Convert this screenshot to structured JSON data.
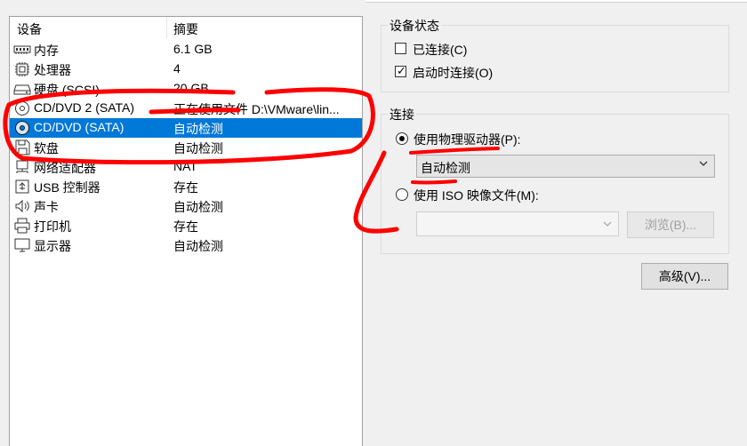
{
  "device_list": {
    "header_device": "设备",
    "header_summary": "摘要",
    "rows": [
      {
        "name": "内存",
        "summary": "6.1 GB",
        "icon": "memory-icon"
      },
      {
        "name": "处理器",
        "summary": "4",
        "icon": "processor-icon"
      },
      {
        "name": "硬盘 (SCSI)",
        "summary": "20 GB",
        "icon": "hard-disk-icon"
      },
      {
        "name": "CD/DVD 2 (SATA)",
        "summary": "正在使用文件 D:\\VMware\\lin...",
        "icon": "cd-dvd-icon"
      },
      {
        "name": "CD/DVD (SATA)",
        "summary": "自动检测",
        "icon": "cd-dvd-icon"
      },
      {
        "name": "软盘",
        "summary": "自动检测",
        "icon": "floppy-icon"
      },
      {
        "name": "网络适配器",
        "summary": "NAT",
        "icon": "network-adapter-icon"
      },
      {
        "name": "USB 控制器",
        "summary": "存在",
        "icon": "usb-icon"
      },
      {
        "name": "声卡",
        "summary": "自动检测",
        "icon": "sound-icon"
      },
      {
        "name": "打印机",
        "summary": "存在",
        "icon": "printer-icon"
      },
      {
        "name": "显示器",
        "summary": "自动检测",
        "icon": "display-icon"
      }
    ],
    "selected_index": 4
  },
  "device_status": {
    "title": "设备状态",
    "connected_label": "已连接(C)",
    "connected_checked": false,
    "connect_on_power_label": "启动时连接(O)",
    "connect_on_power_checked": true
  },
  "connection": {
    "title": "连接",
    "physical_drive_label": "使用物理驱动器(P):",
    "physical_drive_selected": true,
    "physical_drive_value": "自动检测",
    "iso_label": "使用 ISO 映像文件(M):",
    "iso_selected": false,
    "iso_value": "",
    "browse_label": "浏览(B)..."
  },
  "advanced_label": "高级(V)...",
  "colors": {
    "selection": "#0078d7",
    "annotation_red": "#ff0000"
  }
}
